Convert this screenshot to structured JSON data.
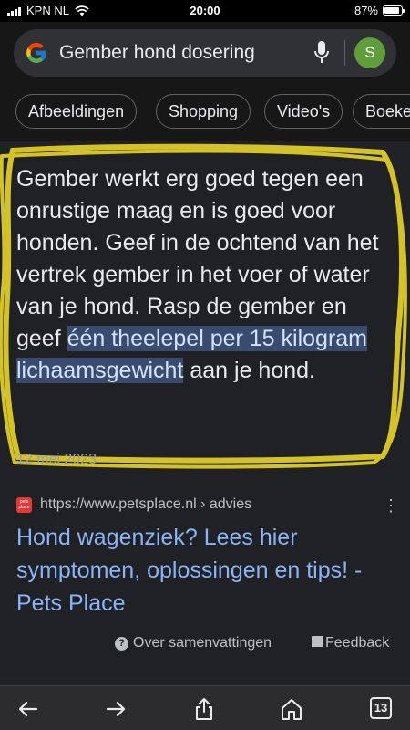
{
  "status_bar": {
    "carrier": "KPN NL",
    "time": "20:00",
    "battery": "87%",
    "battery_level": 0.87,
    "icons": [
      "signal-icon",
      "wifi-icon",
      "battery-icon"
    ]
  },
  "search": {
    "query": "Gember hond dosering",
    "avatar_initial": "S",
    "avatar_color": "#5f9e3a"
  },
  "chips": [
    "Afbeeldingen",
    "Shopping",
    "Video's",
    "Boeken"
  ],
  "snippet": {
    "text_before": "Gember werkt erg goed tegen een onrustige maag en is goed voor honden. Geef in de ochtend van het vertrek gember in het voer of water van je hond. Rasp de gember en geef ",
    "text_highlight": "één theelepel per 15 kilogram lichaamsgewicht",
    "text_after": " aan je hond.",
    "date": "12 mei 2023",
    "highlight_color": "#394c70",
    "annotation_color": "#d4c227"
  },
  "source": {
    "favicon_text": "pets place",
    "url": "https://www.petsplace.nl › advies",
    "title": "Hond wagenziek? Lees hier symptomen, oplossingen en tips! - Pets Place"
  },
  "footer": {
    "about_label": "Over samenvattingen",
    "feedback_label": "Feedback"
  },
  "bottom_nav": {
    "tab_count": "13",
    "icons": [
      "back-arrow-icon",
      "forward-arrow-icon",
      "share-icon",
      "home-icon",
      "tabs-icon"
    ]
  },
  "colors": {
    "link": "#8ab4f8",
    "background": "#202124"
  }
}
